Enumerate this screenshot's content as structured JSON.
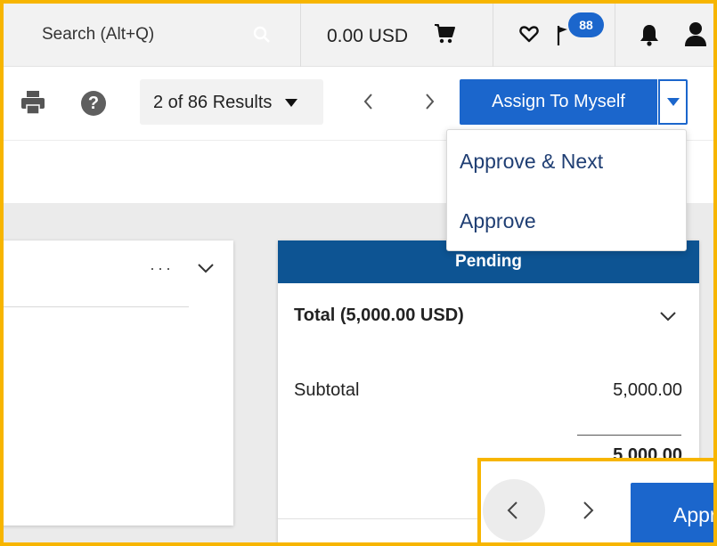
{
  "topbar": {
    "search_placeholder": "Search (Alt+Q)",
    "cart_amount": "0.00 USD",
    "notification_count": "88"
  },
  "toolbar": {
    "results_label": "2 of 86 Results",
    "assign_label": "Assign To Myself",
    "help_glyph": "?"
  },
  "dropdown": {
    "items": [
      {
        "label": "Approve & Next"
      },
      {
        "label": "Approve"
      }
    ]
  },
  "left_card": {
    "more_glyph": "···"
  },
  "status_card": {
    "status": "Pending",
    "total_label": "Total (5,000.00 USD)",
    "subtotal_label": "Subtotal",
    "subtotal_value": "5,000.00",
    "sum_value": "5,000.00"
  },
  "bottom_pager": {
    "button_label": "Approve"
  },
  "colors": {
    "primary": "#1b66cc",
    "status_header": "#0d5493",
    "highlight": "#f7b500",
    "menu_text": "#1f3e73"
  },
  "icons": [
    "search-icon",
    "cart-icon",
    "heart-icon",
    "flag-icon",
    "bell-icon",
    "user-icon",
    "print-icon",
    "help-icon",
    "chevron-left-icon",
    "chevron-right-icon",
    "chevron-down-icon",
    "caret-down-icon",
    "more-icon"
  ]
}
